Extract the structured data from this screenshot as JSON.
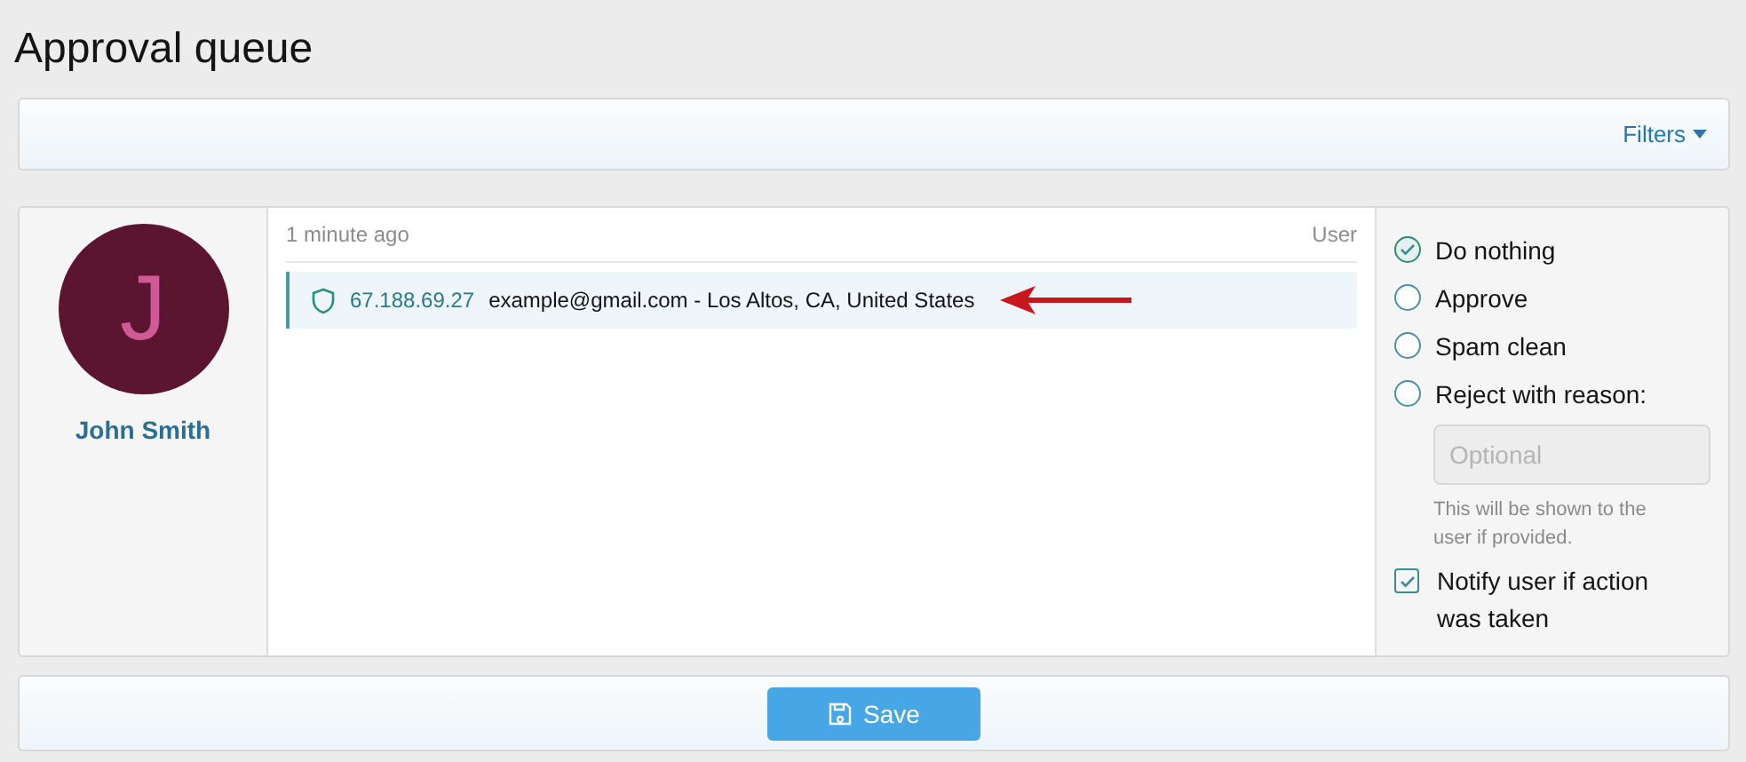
{
  "title": "Approval queue",
  "filters": {
    "label": "Filters"
  },
  "user": {
    "initial": "J",
    "name": "John Smith"
  },
  "entry": {
    "time": "1 minute ago",
    "type": "User",
    "ip": "67.188.69.27",
    "detail": "example@gmail.com - Los Altos, CA, United States"
  },
  "actions": [
    {
      "label": "Do nothing",
      "selected": true
    },
    {
      "label": "Approve",
      "selected": false
    },
    {
      "label": "Spam clean",
      "selected": false
    },
    {
      "label": "Reject with reason:",
      "selected": false
    }
  ],
  "reason": {
    "placeholder": "Optional",
    "hint": "This will be shown to the user if provided."
  },
  "notify": {
    "label": "Notify user if action was taken",
    "checked": true
  },
  "save": {
    "label": "Save"
  }
}
